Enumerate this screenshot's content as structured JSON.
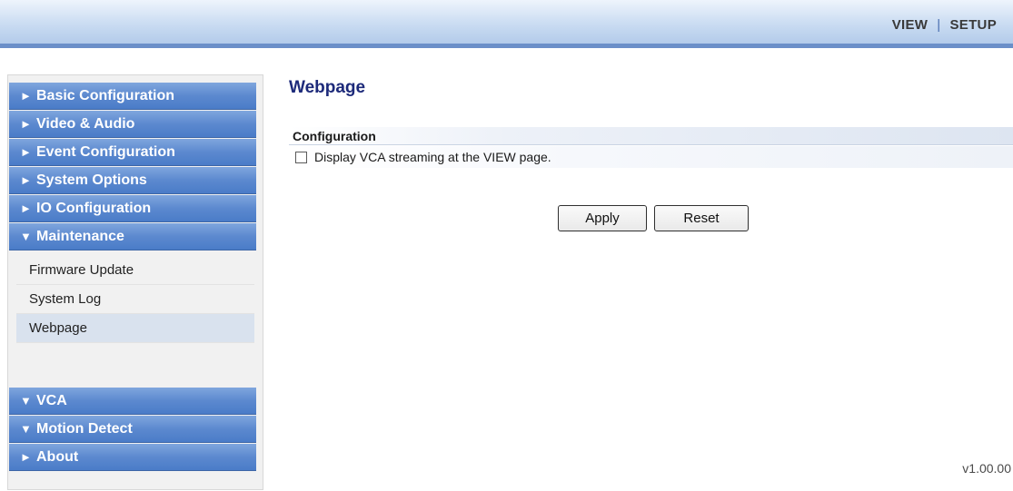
{
  "topnav": {
    "view": "VIEW",
    "separator": "|",
    "setup": "SETUP"
  },
  "sidebar": {
    "menus_top": [
      {
        "arrow": "►",
        "label": "Basic Configuration"
      },
      {
        "arrow": "►",
        "label": "Video & Audio"
      },
      {
        "arrow": "►",
        "label": "Event Configuration"
      },
      {
        "arrow": "►",
        "label": "System Options"
      },
      {
        "arrow": "►",
        "label": "IO Configuration"
      },
      {
        "arrow": "▼",
        "label": "Maintenance"
      }
    ],
    "maintenance_items": [
      {
        "label": "Firmware Update"
      },
      {
        "label": "System Log"
      },
      {
        "label": "Webpage"
      }
    ],
    "menus_bottom": [
      {
        "arrow": "▼",
        "label": "VCA"
      },
      {
        "arrow": "▼",
        "label": "Motion Detect"
      },
      {
        "arrow": "►",
        "label": "About"
      }
    ]
  },
  "main": {
    "title": "Webpage",
    "section": "Configuration",
    "option_label": "Display VCA streaming at the VIEW page.",
    "apply_label": "Apply",
    "reset_label": "Reset"
  },
  "footer": {
    "version": "v1.00.00"
  }
}
